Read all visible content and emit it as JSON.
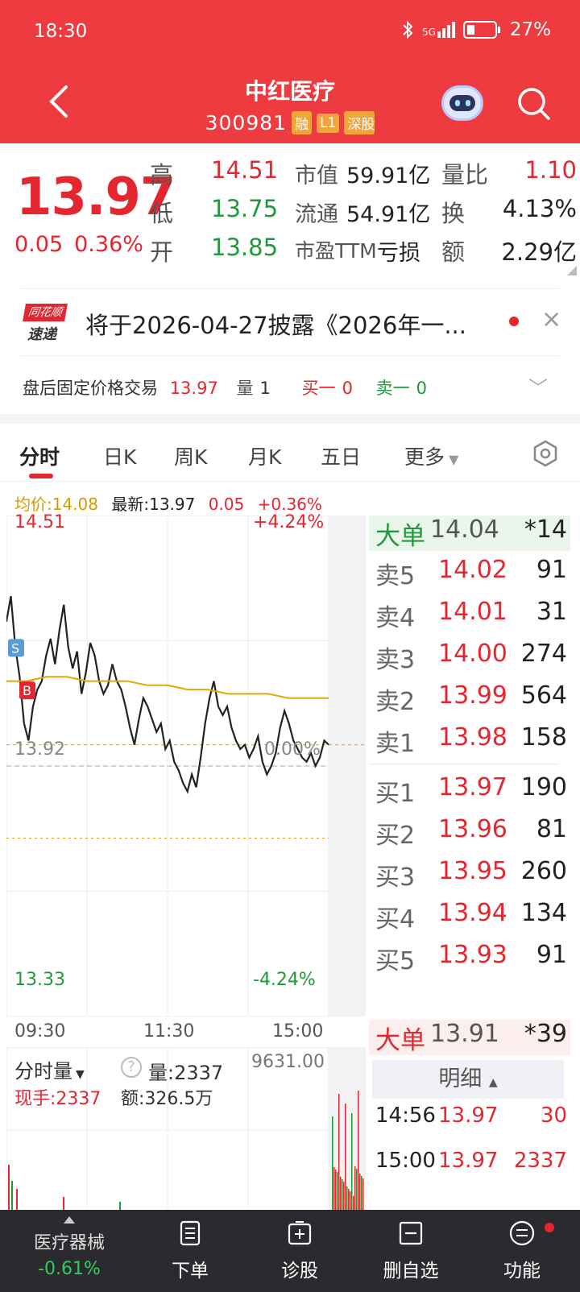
{
  "status": {
    "time": "18:30",
    "network": "5G",
    "battery": "27%"
  },
  "header": {
    "name": "中红医疗",
    "code": "300981",
    "tags": [
      "融",
      "L1",
      "深股"
    ]
  },
  "quote": {
    "price": "13.97",
    "change": "0.05",
    "change_pct": "0.36%",
    "high_label": "高",
    "high": "14.51",
    "low_label": "低",
    "low": "13.75",
    "open_label": "开",
    "open": "13.85",
    "mktcap_label": "市值",
    "mktcap": "59.91亿",
    "float_label": "流通",
    "float": "54.91亿",
    "pe_label": "市盈TTM",
    "pe": "亏损",
    "vr_label": "量比",
    "vr": "1.10",
    "turn_label": "换",
    "turn": "4.13%",
    "amt_label": "额",
    "amt": "2.29亿"
  },
  "news": {
    "logo_top": "同花顺",
    "logo_bottom": "速递",
    "text": "将于2026-04-27披露《2026年一..."
  },
  "afterhours": {
    "label": "盘后固定价格交易",
    "price": "13.97",
    "vol_label": "量",
    "vol": "1",
    "buy1_label": "买一",
    "buy1": "0",
    "sell1_label": "卖一",
    "sell1": "0"
  },
  "tabs": [
    "分时",
    "日K",
    "周K",
    "月K",
    "五日",
    "更多"
  ],
  "infoline": {
    "avg_label": "均价:14.08",
    "latest_label": "最新:13.97",
    "change": "0.05",
    "change_pct": "+0.36%"
  },
  "chart_data": {
    "type": "line",
    "y_max_label": "14.51",
    "y_min_label": "13.33",
    "ref_label": "13.92",
    "pct_max_label": "+4.24%",
    "pct_min_label": "-4.24%",
    "pct_ref_label": "0.00%",
    "x_labels": [
      "09:30",
      "11:30",
      "15:00"
    ],
    "ylim": [
      13.33,
      14.51
    ],
    "series": [
      {
        "values": [
          14.26,
          14.32,
          14.2,
          14.13,
          14.02,
          13.98,
          14.06,
          14.1,
          14.12,
          14.18,
          14.22,
          14.16,
          14.24,
          14.3,
          14.2,
          14.15,
          14.19,
          14.09,
          14.14,
          14.21,
          14.18,
          14.12,
          14.09,
          14.11,
          14.16,
          14.12,
          14.1,
          14.06,
          14.01,
          13.97,
          14.03,
          14.08,
          14.06,
          14.03,
          14.0,
          14.02,
          13.96,
          13.98,
          13.93,
          13.91,
          13.88,
          13.86,
          13.9,
          13.87,
          13.94,
          14.02,
          14.08,
          14.12,
          14.06,
          14.04,
          14.06,
          14.01,
          13.98,
          13.96,
          13.97,
          13.94,
          13.96,
          13.99,
          13.93,
          13.9,
          13.92,
          13.95,
          14.01,
          14.05,
          14.02,
          13.98,
          13.96,
          13.94,
          13.93,
          13.95,
          13.92,
          13.94,
          13.98,
          13.97
        ]
      },
      {
        "values": [
          14.12,
          14.12,
          14.13,
          14.13,
          14.12,
          14.12,
          14.12,
          14.11,
          14.11,
          14.1,
          14.1,
          14.09,
          14.09,
          14.09,
          14.08,
          14.08,
          14.08
        ]
      }
    ]
  },
  "volume": {
    "selector": "分时量",
    "vol_label": "量:2337",
    "max_label": "9631.00",
    "cur_label": "现手:2337",
    "amt_label": "额:326.5万"
  },
  "orderbook": {
    "big_sell": {
      "label": "大单",
      "price": "14.04",
      "vol": "*14"
    },
    "asks": [
      {
        "label": "卖5",
        "price": "14.02",
        "vol": "91"
      },
      {
        "label": "卖4",
        "price": "14.01",
        "vol": "31"
      },
      {
        "label": "卖3",
        "price": "14.00",
        "vol": "274"
      },
      {
        "label": "卖2",
        "price": "13.99",
        "vol": "564"
      },
      {
        "label": "卖1",
        "price": "13.98",
        "vol": "158"
      }
    ],
    "bids": [
      {
        "label": "买1",
        "price": "13.97",
        "vol": "190"
      },
      {
        "label": "买2",
        "price": "13.96",
        "vol": "81"
      },
      {
        "label": "买3",
        "price": "13.95",
        "vol": "260"
      },
      {
        "label": "买4",
        "price": "13.94",
        "vol": "134"
      },
      {
        "label": "买5",
        "price": "13.93",
        "vol": "91"
      }
    ],
    "big_buy": {
      "label": "大单",
      "price": "13.91",
      "vol": "*39"
    },
    "detail_label": "明细",
    "ticks": [
      {
        "time": "14:56",
        "price": "13.97",
        "vol": "30"
      },
      {
        "time": "15:00",
        "price": "13.97",
        "vol": "2337"
      }
    ]
  },
  "bottombar": {
    "sector": "医疗器械",
    "sector_pct": "-0.61%",
    "items": [
      "下单",
      "诊股",
      "删自选",
      "功能"
    ]
  }
}
